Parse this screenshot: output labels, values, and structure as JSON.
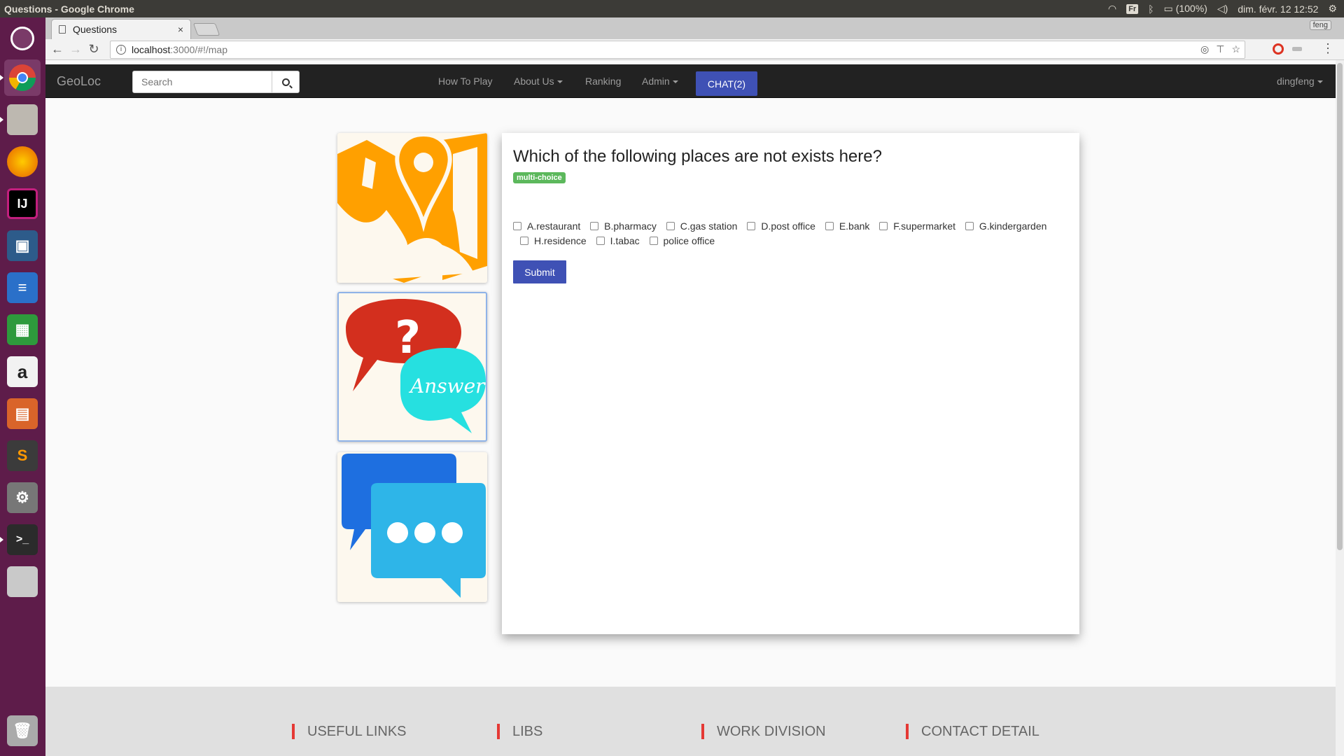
{
  "os": {
    "window_title": "Questions - Google Chrome",
    "keyboard_layout": "Fr",
    "battery": "(100%)",
    "clock": "dim. févr. 12 12:52"
  },
  "launcher": {
    "apps": [
      "ubuntu-dash",
      "chrome",
      "files",
      "firefox",
      "intellij",
      "virtualbox",
      "libreoffice-writer",
      "libreoffice-calc",
      "amazon",
      "libreoffice-impress",
      "sublime-text",
      "system-settings",
      "terminal",
      "disk",
      "trash"
    ]
  },
  "browser": {
    "tab_title": "Questions",
    "tab_close": "×",
    "url_host": "localhost",
    "url_path": ":3000/#!/map",
    "user_chip": "feng"
  },
  "navbar": {
    "brand": "GeoLoc",
    "search_placeholder": "Search",
    "links": {
      "how_to_play": "How To Play",
      "about_us": "About Us",
      "ranking": "Ranking",
      "admin": "Admin",
      "chat": "CHAT(2)",
      "user": "dingfeng"
    }
  },
  "question": {
    "title": "Which of the following places are not exists here?",
    "badge": "multi-choice",
    "options": [
      "A.restaurant",
      "B.pharmacy",
      "C.gas station",
      "D.post office",
      "E.bank",
      "F.supermarket",
      "G.kindergarden",
      "H.residence",
      "I.tabac",
      "police office"
    ],
    "submit_label": "Submit"
  },
  "cards": {
    "map": "map-pin",
    "qa": "Answer",
    "chat": "chat-bubbles"
  },
  "footer": {
    "useful_links": "USEFUL LINKS",
    "libs": "LIBS",
    "work_division": "WORK DIVISION",
    "contact_detail": "CONTACT DETAIL"
  },
  "colors": {
    "accent": "#3f51b5",
    "badge": "#5cb85c",
    "footer_bar": "#e53935",
    "map_orange": "#ffa000",
    "bubble_red": "#d32f1e",
    "bubble_cyan": "#26e0e0",
    "chat_blue": "#1e88e5"
  }
}
